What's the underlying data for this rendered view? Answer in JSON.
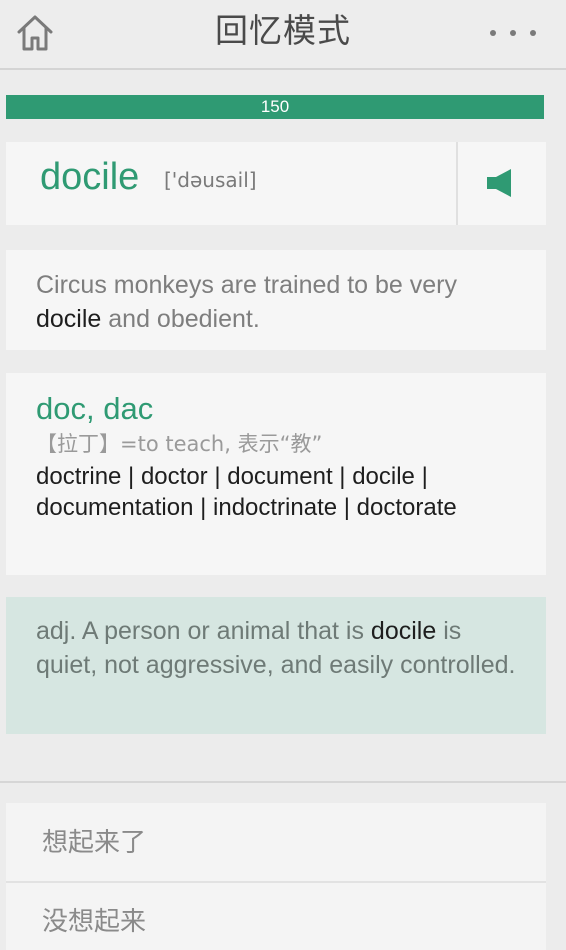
{
  "header": {
    "title": "回忆模式",
    "home_icon": "home-icon",
    "more_icon": "more-icon"
  },
  "progress": {
    "label": "150",
    "fraction": 1.0,
    "color": "#2f9a73"
  },
  "word": {
    "text": "docile",
    "phonetic": "['dəusail]",
    "sound_icon": "speaker-icon"
  },
  "example": {
    "before": "Circus monkeys are trained to be very ",
    "highlight": "docile",
    "after": " and obedient."
  },
  "root": {
    "title": "doc, dac",
    "meaning": "【拉丁】=to teach, 表示“教”",
    "related": "doctrine | doctor | document | docile | documentation | indoctrinate | doctorate"
  },
  "definition": {
    "before": "adj. A person or animal that is ",
    "highlight": "docile",
    "after": " is quiet, not aggressive, and easily controlled."
  },
  "options": {
    "remember": "想起来了",
    "forget": "没想起来"
  },
  "colors": {
    "accent": "#2f9a73",
    "definition_bg": "#d6e6e1",
    "background": "#ececec"
  }
}
